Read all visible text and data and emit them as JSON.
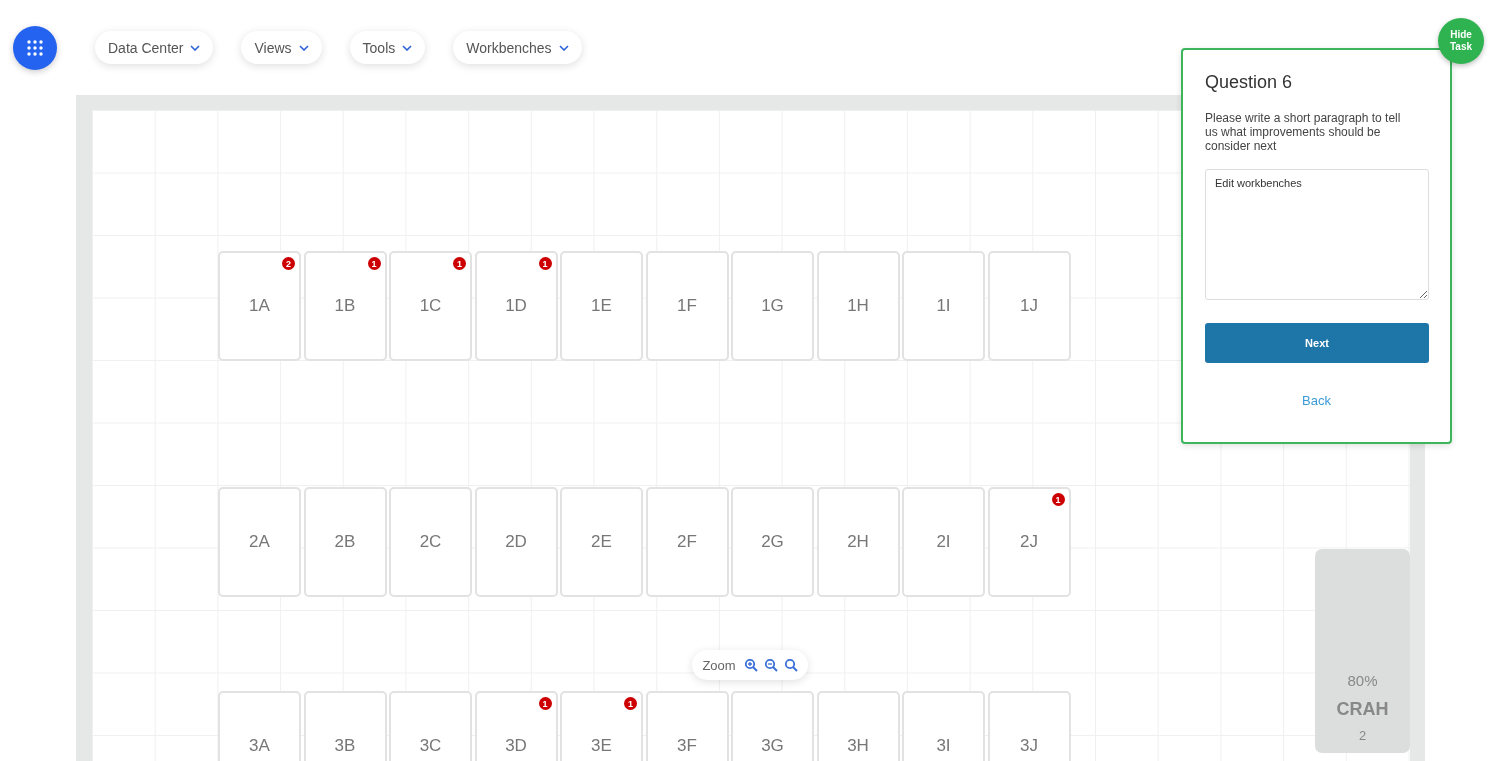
{
  "nav": {
    "menus": [
      {
        "label": "Data Center"
      },
      {
        "label": "Views"
      },
      {
        "label": "Tools"
      },
      {
        "label": "Workbenches"
      }
    ]
  },
  "floor": {
    "rows": [
      {
        "racks": [
          {
            "label": "1A",
            "alerts": "2"
          },
          {
            "label": "1B",
            "alerts": "1"
          },
          {
            "label": "1C",
            "alerts": "1"
          },
          {
            "label": "1D",
            "alerts": "1"
          },
          {
            "label": "1E"
          },
          {
            "label": "1F"
          },
          {
            "label": "1G"
          },
          {
            "label": "1H"
          },
          {
            "label": "1I"
          },
          {
            "label": "1J"
          }
        ]
      },
      {
        "racks": [
          {
            "label": "2A"
          },
          {
            "label": "2B"
          },
          {
            "label": "2C"
          },
          {
            "label": "2D"
          },
          {
            "label": "2E"
          },
          {
            "label": "2F"
          },
          {
            "label": "2G"
          },
          {
            "label": "2H"
          },
          {
            "label": "2I"
          },
          {
            "label": "2J",
            "alerts": "1"
          }
        ]
      },
      {
        "racks": [
          {
            "label": "3A"
          },
          {
            "label": "3B"
          },
          {
            "label": "3C"
          },
          {
            "label": "3D",
            "alerts": "1"
          },
          {
            "label": "3E",
            "alerts": "1"
          },
          {
            "label": "3F"
          },
          {
            "label": "3G"
          },
          {
            "label": "3H"
          },
          {
            "label": "3I"
          },
          {
            "label": "3J"
          }
        ]
      }
    ],
    "crah": {
      "load": "80%",
      "name": "CRAH",
      "number": "2"
    },
    "zoom": {
      "label": "Zoom"
    }
  },
  "task": {
    "hide_button": "Hide Task",
    "title": "Question 6",
    "prompt": "Please write a short paragraph to tell us what improvements should be consider next",
    "answer": "Edit workbenches",
    "next_button": "Next",
    "back_link": "Back"
  }
}
